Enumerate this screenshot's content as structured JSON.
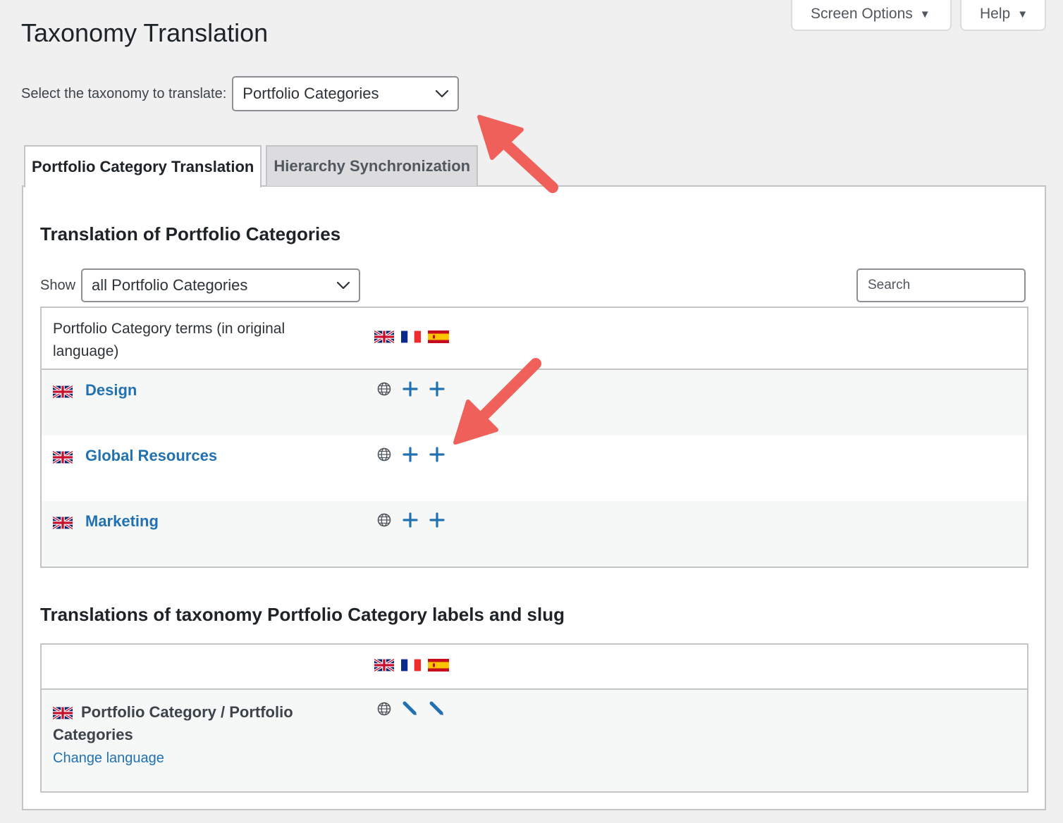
{
  "screen_meta": {
    "screen_options": "Screen Options",
    "help": "Help",
    "caret": "▼"
  },
  "page": {
    "title": "Taxonomy Translation"
  },
  "taxonomy_select": {
    "label": "Select the taxonomy to translate:",
    "value": "Portfolio Categories"
  },
  "tabs": [
    {
      "label": "Portfolio Category Translation",
      "active": true
    },
    {
      "label": "Hierarchy Synchronization",
      "active": false
    }
  ],
  "terms_section": {
    "title": "Translation of Portfolio Categories",
    "show_label": "Show",
    "show_value": "all Portfolio Categories",
    "search_placeholder": "Search",
    "header": "Portfolio Category terms (in original language)",
    "languages": [
      "English",
      "French",
      "Spanish"
    ],
    "rows": [
      {
        "name": "Design"
      },
      {
        "name": "Global Resources"
      },
      {
        "name": "Marketing"
      }
    ]
  },
  "labels_section": {
    "title": "Translations of taxonomy Portfolio Category labels and slug",
    "row_title": "Portfolio Category / Portfolio Categories",
    "change_language": "Change language"
  },
  "colors": {
    "link": "#2271b1",
    "arrow": "#f0605a",
    "tab_inactive": "#dcdcde"
  },
  "icons": [
    "uk-flag-icon",
    "france-flag-icon",
    "spain-flag-icon",
    "globe-icon",
    "plus-icon",
    "pencil-icon",
    "chevron-down-icon"
  ]
}
